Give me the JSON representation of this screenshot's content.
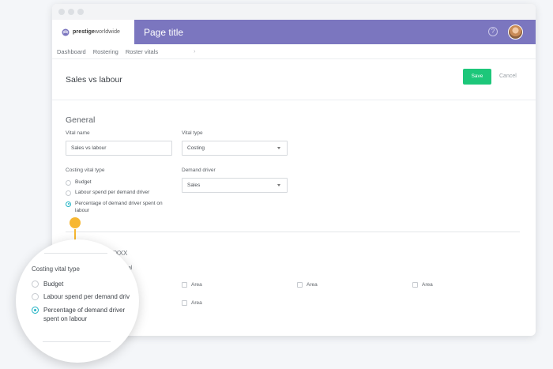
{
  "app": {
    "brand_bold": "prestige",
    "brand_regular": "worldwide",
    "page_title": "Page title",
    "help_glyph": "?",
    "colors": {
      "appbar": "#7b76bf",
      "primary": "#1dc77a",
      "accent": "#22b3c4",
      "highlight": "#f7b731"
    }
  },
  "subnav": {
    "items": [
      "Dashboard",
      "Rostering",
      "Roster vitals"
    ],
    "chevron": "›"
  },
  "header": {
    "title": "Sales vs labour",
    "save_label": "Save",
    "cancel_label": "Cancel"
  },
  "general": {
    "title": "General",
    "vital_name_label": "Vital name",
    "vital_name_value": "Sales vs labour",
    "vital_type_label": "Vital type",
    "vital_type_value": "Costing",
    "costing_vital_type_label": "Costing vital type",
    "costing_options": [
      {
        "label": "Budget",
        "checked": false
      },
      {
        "label": "Labour spend per demand driver",
        "checked": false
      },
      {
        "label": "Percentage of demand driver spent on labour",
        "checked": true
      }
    ],
    "demand_driver_label": "Demand driver",
    "demand_driver_value": "Sales"
  },
  "lower": {
    "partial_heading": "XXXX",
    "partial_label": "tal",
    "partial_question": "s?",
    "area_label": "Area"
  },
  "magnifier": {
    "label": "Costing vital type",
    "options": [
      {
        "text": "Budget",
        "checked": false
      },
      {
        "text": "Labour spend per demand driv",
        "checked": false
      },
      {
        "text": "Percentage of demand driver",
        "checked": true
      }
    ],
    "option3_line2": "spent on labour"
  },
  "icons": [
    "brand-logo-icon",
    "help-icon",
    "avatar",
    "chevron-down-icon",
    "radio-icon",
    "checkbox-icon"
  ]
}
